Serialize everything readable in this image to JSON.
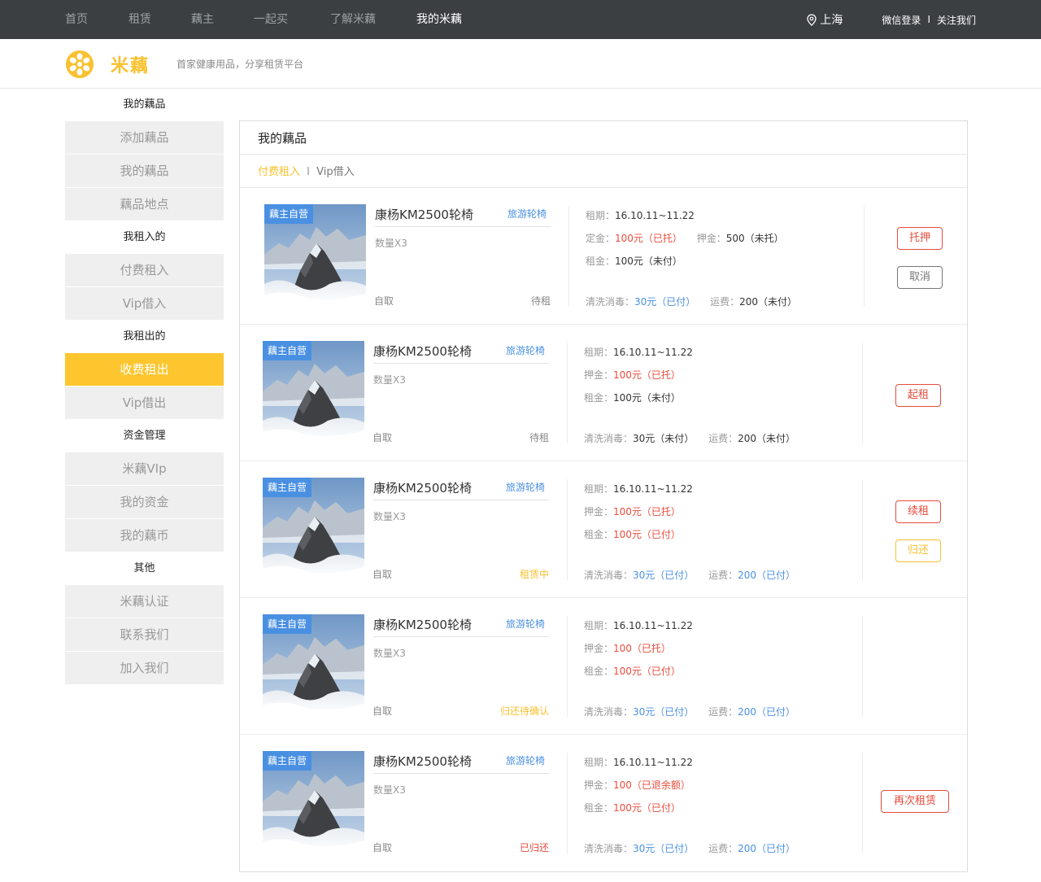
{
  "nav": {
    "links": [
      "首页",
      "租赁",
      "藕主",
      "一起买",
      "了解米藕",
      "我的米藕"
    ],
    "active_index": 5,
    "location": "上海",
    "login": "微信登录",
    "separator": "I",
    "follow": "关注我们"
  },
  "brand": {
    "name": "米藕",
    "slogan": "首家健康用品，分享租赁平台",
    "color": "#f9c12e"
  },
  "sidebar": {
    "groups": [
      {
        "title": "我的藕品",
        "items": [
          "添加藕品",
          "我的藕品",
          "藕品地点"
        ]
      },
      {
        "title": "我租入的",
        "items": [
          "付费租入",
          "Vip借入"
        ]
      },
      {
        "title": "我租出的",
        "items": [
          "收费租出",
          "Vip借出"
        ]
      },
      {
        "title": "资金管理",
        "items": [
          "米藕VIp",
          "我的资金",
          "我的藕币"
        ]
      },
      {
        "title": "其他",
        "items": [
          "米藕认证",
          "联系我们",
          "加入我们"
        ]
      }
    ],
    "active_item": "收费租出"
  },
  "panel": {
    "title": "我的藕品",
    "tab_active": "付费租入",
    "tab_sep": "I",
    "tab_other": "Vip借入"
  },
  "labels": {
    "period": "租期：",
    "deposit_fixed": "定金：",
    "deposit": "押金：",
    "rent": "租金：",
    "cleaning": "清洗消毒：",
    "shipping": "运费："
  },
  "rows": [
    {
      "badge": "藕主自营",
      "name": "康杨KM2500轮椅",
      "tag": "旅游轮椅",
      "qty": "数量X3",
      "pickup": "自取",
      "status": "待租",
      "status_color": "gray",
      "period": "16.10.11~11.22",
      "fixed_deposit": "100元（已托）",
      "deposit": "500（未托）",
      "deposit_color": "dark",
      "rent": "100元（未付）",
      "rent_color": "dark",
      "cleaning": "30元（已付）",
      "cleaning_color": "blue",
      "shipping": "200（未付）",
      "shipping_color": "dark",
      "buttons": [
        {
          "label": "托押",
          "style": "red"
        },
        {
          "label": "取消",
          "style": "gray"
        }
      ]
    },
    {
      "badge": "藕主自营",
      "name": "康杨KM2500轮椅",
      "tag": "旅游轮椅",
      "qty": "数量X3",
      "pickup": "自取",
      "status": "待租",
      "status_color": "gray",
      "period": "16.10.11~11.22",
      "deposit": "100元（已托）",
      "deposit_color": "red",
      "rent": "100元（未付）",
      "rent_color": "dark",
      "cleaning": "30元（未付）",
      "cleaning_color": "dark",
      "shipping": "200（未付）",
      "shipping_color": "dark",
      "buttons": [
        {
          "label": "起租",
          "style": "red"
        }
      ]
    },
    {
      "badge": "藕主自营",
      "name": "康杨KM2500轮椅",
      "tag": "旅游轮椅",
      "qty": "数量X3",
      "pickup": "自取",
      "status": "租赁中",
      "status_color": "yellow",
      "period": "16.10.11~11.22",
      "deposit": "100元（已托）",
      "deposit_color": "red",
      "rent": "100元（已付）",
      "rent_color": "red",
      "cleaning": "30元（已付）",
      "cleaning_color": "blue",
      "shipping": "200（已付）",
      "shipping_color": "blue",
      "buttons": [
        {
          "label": "续租",
          "style": "red"
        },
        {
          "label": "归还",
          "style": "yellow"
        }
      ]
    },
    {
      "badge": "藕主自营",
      "name": "康杨KM2500轮椅",
      "tag": "旅游轮椅",
      "qty": "数量X3",
      "pickup": "自取",
      "status": "归还待确认",
      "status_color": "yellow",
      "period": "16.10.11~11.22",
      "deposit": "100（已托）",
      "deposit_color": "red",
      "rent": "100元（已付）",
      "rent_color": "red",
      "cleaning": "30元（已付）",
      "cleaning_color": "blue",
      "shipping": "200（已付）",
      "shipping_color": "blue",
      "buttons": []
    },
    {
      "badge": "藕主自营",
      "name": "康杨KM2500轮椅",
      "tag": "旅游轮椅",
      "qty": "数量X3",
      "pickup": "自取",
      "status": "已归还",
      "status_color": "red",
      "period": "16.10.11~11.22",
      "deposit": "100（已退余额）",
      "deposit_color": "red",
      "rent": "100元（已付）",
      "rent_color": "red",
      "cleaning": "30元（已付）",
      "cleaning_color": "blue",
      "shipping": "200（已付）",
      "shipping_color": "blue",
      "buttons": [
        {
          "label": "再次租赁",
          "style": "red"
        }
      ]
    }
  ]
}
